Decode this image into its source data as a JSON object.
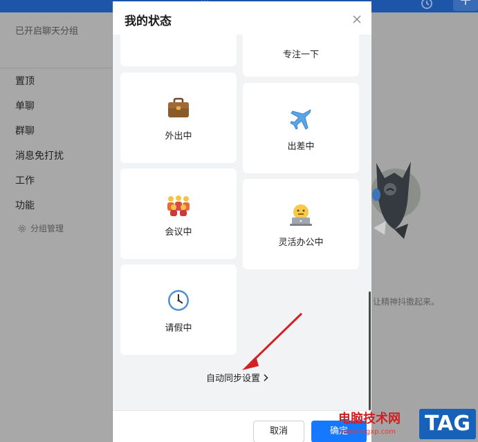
{
  "background_app": {
    "topbar_title": "...",
    "sidebar": {
      "header": "已开启聊天分组",
      "quick_icons": [
        "at-icon",
        "star-icon",
        "recent-icon",
        "file-icon",
        "doc-icon"
      ],
      "items": [
        {
          "label": "置顶"
        },
        {
          "label": "单聊"
        },
        {
          "label": "群聊"
        },
        {
          "label": "消息免打扰"
        },
        {
          "label": "工作"
        },
        {
          "label": "功能"
        }
      ],
      "group_manage": "分组管理"
    },
    "hint_text": "让精神抖擞起来。"
  },
  "dialog": {
    "title": "我的状态",
    "statuses": [
      {
        "label": "...",
        "icon": "none"
      },
      {
        "label": "专注一下",
        "icon": "none"
      },
      {
        "label": "外出中",
        "icon": "briefcase-icon"
      },
      {
        "label": "出差中",
        "icon": "airplane-icon"
      },
      {
        "label": "会议中",
        "icon": "meeting-icon"
      },
      {
        "label": "灵活办公中",
        "icon": "laptop-worker-icon"
      },
      {
        "label": "请假中",
        "icon": "clock-icon"
      }
    ],
    "auto_sync": "自动同步设置",
    "cancel_label": "取消",
    "confirm_label": "确定"
  },
  "watermark": {
    "title": "电脑技术网",
    "url": "www.tagxp.com",
    "tag": "TAG"
  },
  "colors": {
    "accent": "#1677ff",
    "topbar": "#1d55a8",
    "arrow": "#d42020"
  }
}
